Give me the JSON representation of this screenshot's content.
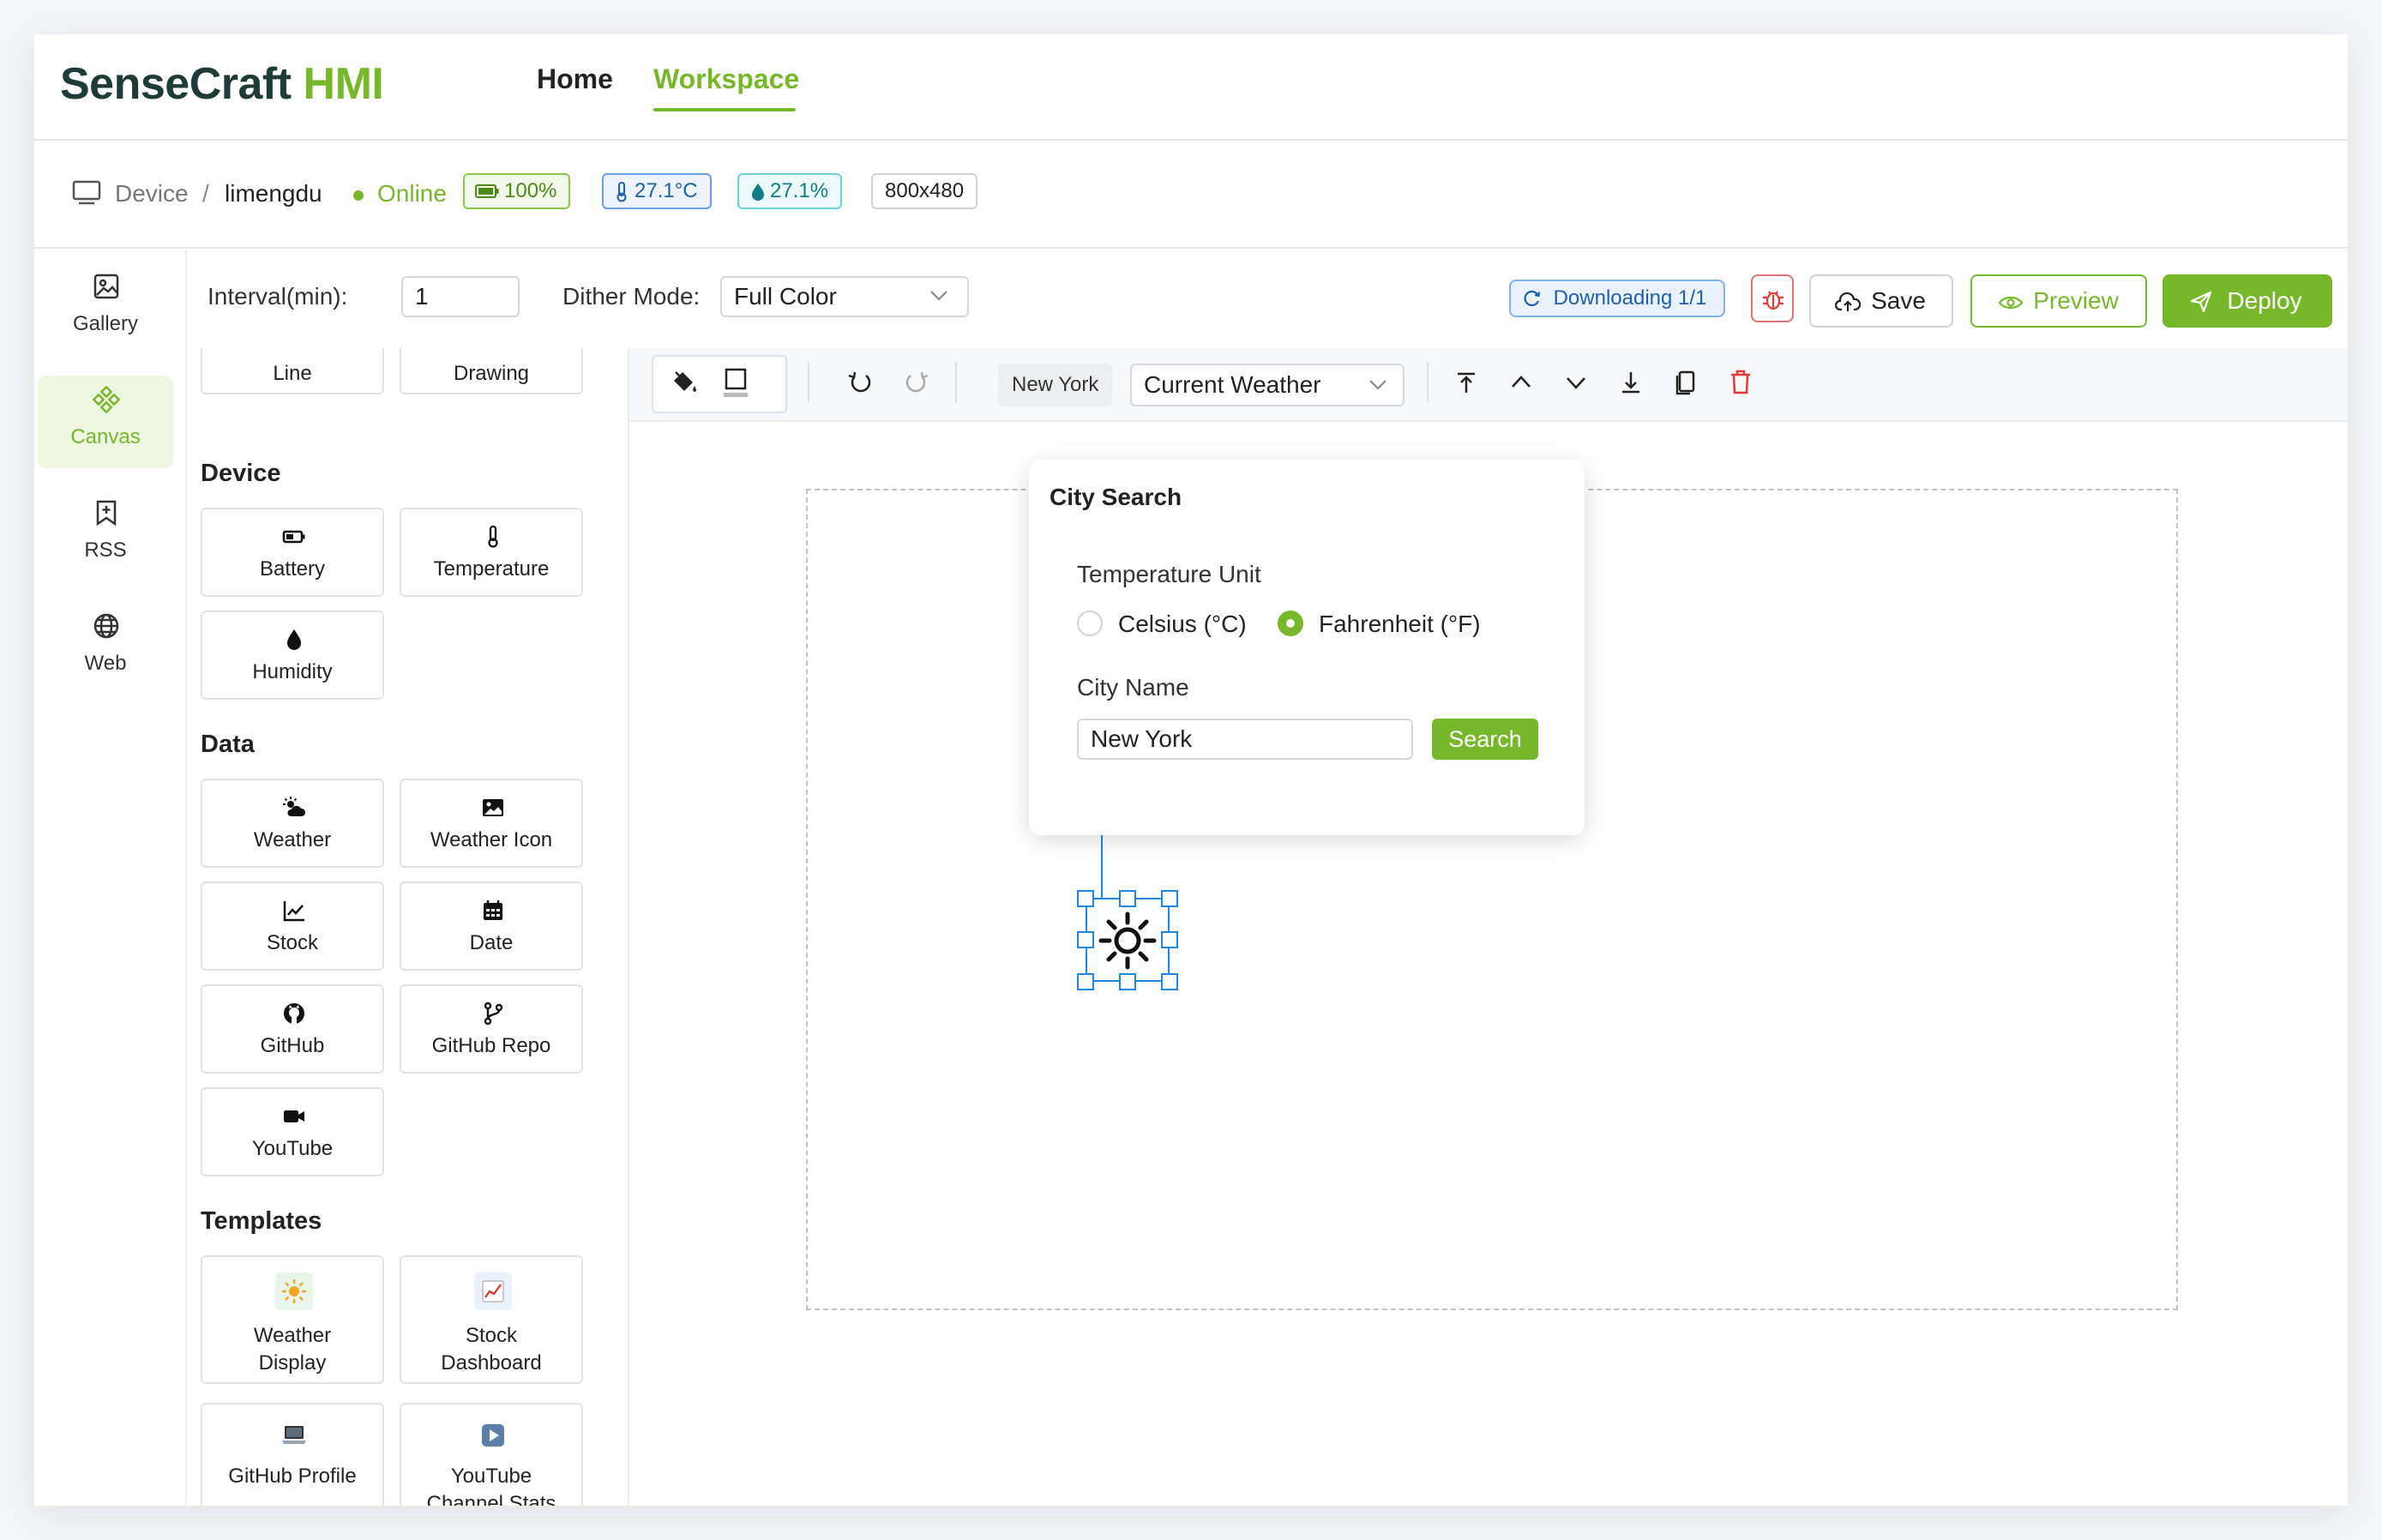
{
  "brand": {
    "name_part1": "SenseCraft",
    "name_part2": "HMI"
  },
  "nav": {
    "home": "Home",
    "workspace": "Workspace"
  },
  "device_bar": {
    "device_label": "Device",
    "separator": "/",
    "device_name": "limengdu",
    "status": "Online",
    "battery": "100%",
    "temperature": "27.1°C",
    "humidity": "27.1%",
    "resolution": "800x480"
  },
  "sidebar": {
    "items": [
      {
        "label": "Gallery",
        "icon": "gallery-icon"
      },
      {
        "label": "Canvas",
        "icon": "canvas-icon"
      },
      {
        "label": "RSS",
        "icon": "rss-icon"
      },
      {
        "label": "Web",
        "icon": "web-icon"
      }
    ]
  },
  "settings": {
    "interval_label": "Interval(min):",
    "interval_value": "1",
    "dither_label": "Dither Mode:",
    "dither_value": "Full Color",
    "downloading": "Downloading 1/1",
    "save": "Save",
    "preview": "Preview",
    "deploy": "Deploy"
  },
  "panel": {
    "top_items": [
      "Line",
      "Drawing"
    ],
    "device_title": "Device",
    "device_items": [
      "Battery",
      "Temperature",
      "Humidity"
    ],
    "data_title": "Data",
    "data_items": [
      "Weather",
      "Weather Icon",
      "Stock",
      "Date",
      "GitHub",
      "GitHub Repo",
      "YouTube"
    ],
    "templates_title": "Templates",
    "template_items": [
      {
        "line1": "Weather",
        "line2": "Display"
      },
      {
        "line1": "Stock",
        "line2": "Dashboard"
      },
      {
        "line1": "GitHub Profile",
        "line2": ""
      },
      {
        "line1": "YouTube",
        "line2": "Channel Stats"
      }
    ]
  },
  "toolbar": {
    "city": "New York",
    "mode": "Current Weather"
  },
  "city_search": {
    "title": "City Search",
    "unit_label": "Temperature Unit",
    "celsius": "Celsius (°C)",
    "fahrenheit": "Fahrenheit (°F)",
    "selected_unit": "fahrenheit",
    "city_label": "City Name",
    "city_value": "New York",
    "search_button": "Search"
  },
  "colors": {
    "accent": "#76b82a",
    "brand_dark": "#1f3b37",
    "blue": "#1e88e5",
    "danger": "#e53935"
  }
}
